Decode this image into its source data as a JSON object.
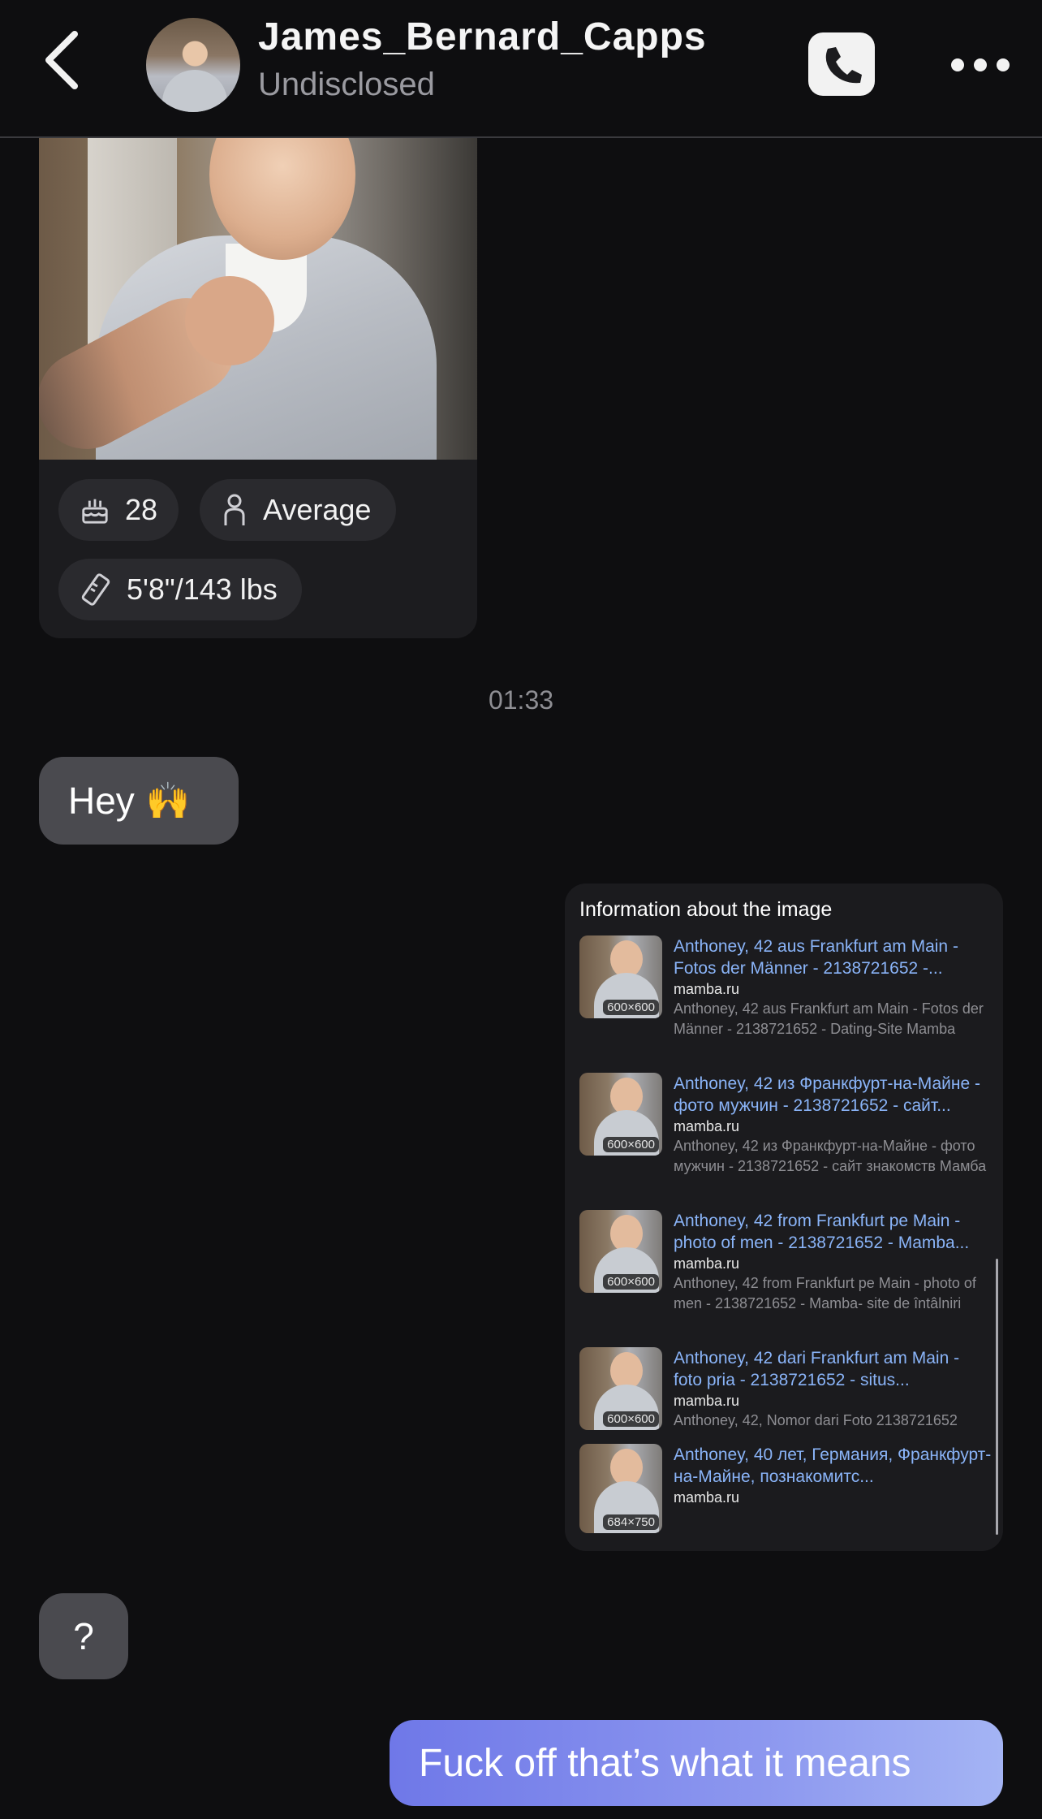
{
  "header": {
    "name": "James_Bernard_Capps",
    "subtitle": "Undisclosed",
    "icons": {
      "back": "chevron-left-icon",
      "call": "phone-icon",
      "more": "more-horizontal-icon"
    }
  },
  "profile": {
    "age": "28",
    "build": "Average",
    "size": "5'8\"/143 lbs",
    "icons": {
      "age": "birthday-cake-icon",
      "build": "person-icon",
      "size": "ruler-icon"
    }
  },
  "chat": {
    "timestamp": "01:33",
    "messages": [
      {
        "from": "them",
        "text": "Hey",
        "emoji": "🙌"
      },
      {
        "from": "them",
        "text": "?"
      },
      {
        "from": "me",
        "text": "Fuck off that’s what it means"
      }
    ]
  },
  "image_info": {
    "title": "Information about the image",
    "results": [
      {
        "title": "Anthoney, 42 aus Frankfurt am Main - Fotos der Männer - 2138721652 -...",
        "domain": "mamba.ru",
        "description": "Anthoney, 42 aus Frankfurt am Main - Fotos der Männer - 2138721652 - Dating-Site Mamba",
        "dimensions": "600×600"
      },
      {
        "title": "Anthoney, 42 из Франкфурт-на-Майне - фото мужчин - 2138721652 - сайт...",
        "domain": "mamba.ru",
        "description": "Anthoney, 42 из Франкфурт-на-Майне - фото мужчин - 2138721652 - сайт знакомств Мамба",
        "dimensions": "600×600"
      },
      {
        "title": "Anthoney, 42 from Frankfurt pe Main - photo of men - 2138721652 - Mamba...",
        "domain": "mamba.ru",
        "description": "Anthoney, 42 from Frankfurt pe Main - photo of men - 2138721652 - Mamba- site de întâlniri",
        "dimensions": "600×600"
      },
      {
        "title": "Anthoney, 42 dari Frankfurt am Main - foto pria - 2138721652 - situs...",
        "domain": "mamba.ru",
        "description": "Anthoney, 42, Nomor dari Foto 2138721652",
        "dimensions": "600×600"
      },
      {
        "title": "Anthoney, 40 лет, Германия, Франкфурт-на-Майне, познакомитс...",
        "domain": "mamba.ru",
        "description": "",
        "dimensions": "684×750"
      }
    ]
  },
  "colors": {
    "background": "#0e0e10",
    "incoming_bubble": "#4a4a4f",
    "outgoing_bubble_start": "#6f78e8",
    "outgoing_bubble_end": "#a4b4f4",
    "link": "#8ab4f8"
  }
}
